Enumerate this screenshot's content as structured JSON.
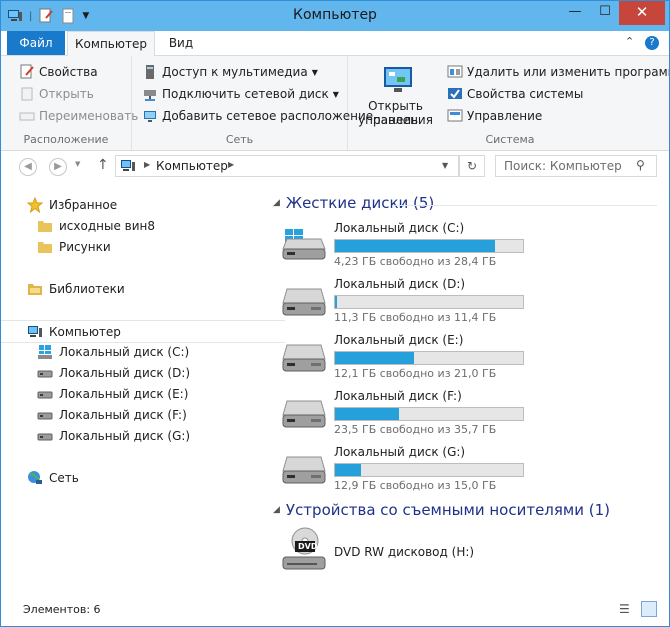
{
  "window": {
    "title": "Компьютер",
    "close_glyph": "✕",
    "minimize_glyph": "—",
    "maximize_glyph": "☐"
  },
  "tabs": {
    "file": "Файл",
    "computer": "Компьютер",
    "view": "Вид"
  },
  "ribbon": {
    "location": {
      "label": "Расположение",
      "properties": "Свойства",
      "open": "Открыть",
      "rename": "Переименовать"
    },
    "network": {
      "label": "Сеть",
      "media_access": "Доступ к мультимедиа",
      "map_drive": "Подключить сетевой диск",
      "add_location": "Добавить сетевое расположение"
    },
    "control_panel": {
      "label1": "Открыть панель",
      "label2": "управления"
    },
    "system": {
      "label": "Система",
      "uninstall": "Удалить или изменить программу",
      "system_props": "Свойства системы",
      "manage": "Управление"
    }
  },
  "address": {
    "path": "Компьютер",
    "search_placeholder": "Поиск: Компьютер"
  },
  "nav": {
    "favorites": "Избранное",
    "fav_items": [
      "исходные вин8",
      "Рисунки"
    ],
    "libraries": "Библиотеки",
    "computer": "Компьютер",
    "drives": [
      "Локальный диск (C:)",
      "Локальный диск (D:)",
      "Локальный диск (E:)",
      "Локальный диск (F:)",
      "Локальный диск (G:)"
    ],
    "network": "Сеть"
  },
  "content": {
    "hdd_header": "Жесткие диски (5)",
    "drives": [
      {
        "name": "Локальный диск (C:)",
        "info": "4,23 ГБ свободно из 28,4 ГБ",
        "used_fraction": 0.85
      },
      {
        "name": "Локальный диск (D:)",
        "info": "11,3 ГБ свободно из 11,4 ГБ",
        "used_fraction": 0.01
      },
      {
        "name": "Локальный диск (E:)",
        "info": "12,1 ГБ свободно из 21,0 ГБ",
        "used_fraction": 0.42
      },
      {
        "name": "Локальный диск (F:)",
        "info": "23,5 ГБ свободно из 35,7 ГБ",
        "used_fraction": 0.34
      },
      {
        "name": "Локальный диск (G:)",
        "info": "12,9 ГБ свободно из 15,0 ГБ",
        "used_fraction": 0.14
      }
    ],
    "removable_header": "Устройства со съемными носителями (1)",
    "dvd": {
      "name": "DVD RW дисковод (H:)",
      "badge": "DVD"
    }
  },
  "status": {
    "items": "Элементов: 6"
  },
  "colors": {
    "accent": "#26a0da",
    "titlebar": "#62b6ee",
    "file_tab": "#1979ca",
    "close": "#c7463c"
  }
}
